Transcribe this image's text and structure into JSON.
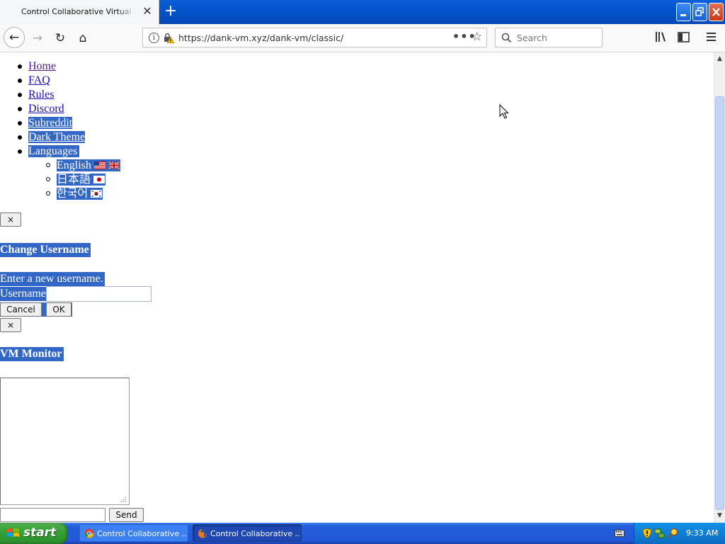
{
  "browser": {
    "tab_title": "Control Collaborative Virtual Machine",
    "new_tab_label": "+",
    "url": "https://dank-vm.xyz/dank-vm/classic/",
    "url_domain": "dank-vm.xyz",
    "search_placeholder": "Search",
    "window_buttons": {
      "minimize": "_",
      "maximize": "❐",
      "close": "✕"
    },
    "nav_glyphs": {
      "back": "←",
      "forward": "→",
      "reload": "↻",
      "home": "⌂",
      "page_actions": "•••",
      "bookmark": "☆",
      "tab_close": "✕"
    }
  },
  "page": {
    "nav_items": [
      {
        "label": "Home",
        "visited": true
      },
      {
        "label": "FAQ",
        "visited": false
      },
      {
        "label": "Rules",
        "visited": false
      },
      {
        "label": "Discord",
        "visited": false
      },
      {
        "label": "Subreddit",
        "visited": false
      },
      {
        "label": "Dark Theme",
        "visited": false
      },
      {
        "label": "Languages",
        "visited": false
      }
    ],
    "languages": [
      {
        "label": "English",
        "flags": [
          "us-flag-icon",
          "uk-flag-icon"
        ]
      },
      {
        "label": "日本語",
        "flags": [
          "japan-flag-icon"
        ]
      },
      {
        "label": "한국어",
        "flags": [
          "korea-flag-icon"
        ]
      }
    ],
    "close_label": "×",
    "change_username": {
      "title": "Change Username",
      "prompt": "Enter a new username.",
      "field_label": "Username",
      "field_value": "",
      "cancel_label": "Cancel",
      "ok_label": "OK"
    },
    "vm_monitor": {
      "title": "VM Monitor",
      "output": "",
      "input_value": "",
      "send_label": "Send"
    }
  },
  "taskbar": {
    "start_label": "start",
    "tasks": [
      {
        "label": "Control Collaborative ...",
        "active": false
      },
      {
        "label": "Control Collaborative ...",
        "active": true
      }
    ],
    "clock": "9:33 AM"
  },
  "colors": {
    "selection": "#3267c8",
    "titlebar": "#0451c8",
    "taskbar": "#245edb",
    "start_green": "#37a137"
  }
}
